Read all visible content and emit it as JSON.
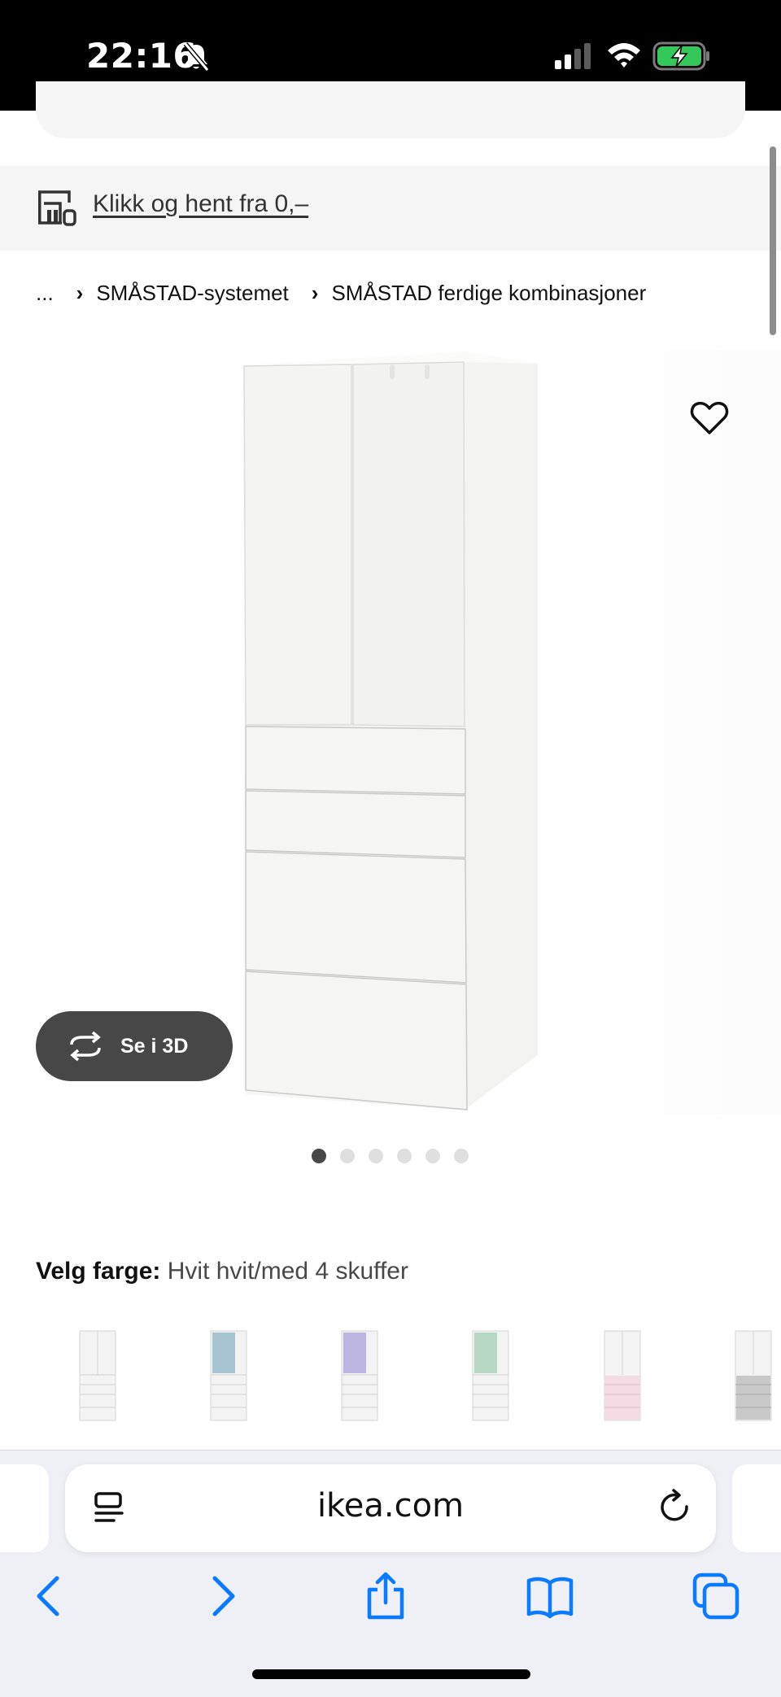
{
  "status_bar": {
    "time": "22:16",
    "icons": [
      "bell-slash-icon",
      "cellular-signal-icon",
      "wifi-icon",
      "battery-charging-icon"
    ]
  },
  "collect_banner": {
    "icon": "store-icon",
    "link_text": "Klikk og hent fra 0,–"
  },
  "breadcrumb": {
    "items": [
      "...",
      "SMÅSTAD-systemet",
      "SMÅSTAD ferdige kombinasjoner"
    ]
  },
  "gallery": {
    "view_3d_label": "Se i 3D",
    "image_count": 6,
    "active_index": 0
  },
  "color_select": {
    "label": "Velg farge:",
    "value": "Hvit hvit/med 4 skuffer",
    "swatches": [
      "hvit",
      "blå",
      "lilla",
      "mint",
      "rosa",
      "grå"
    ]
  },
  "browser": {
    "url": "ikea.com"
  },
  "colors": {
    "status_bar_bg": "#000000",
    "banner_bg": "#f5f5f5",
    "button_dark": "#474747",
    "safari_blue": "#0a7aff",
    "battery_green": "#34c759"
  }
}
